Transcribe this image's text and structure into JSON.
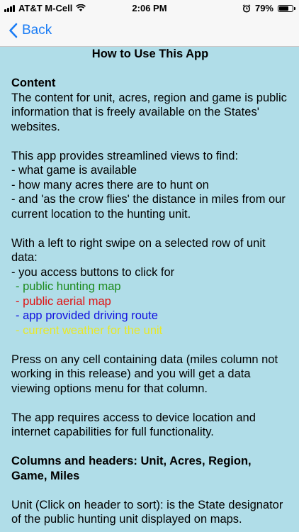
{
  "status_bar": {
    "carrier": "AT&T M-Cell",
    "time": "2:06 PM",
    "battery_percent": "79%",
    "battery_level": 0.79
  },
  "nav": {
    "back_label": "Back"
  },
  "page_title": "How to Use This App",
  "content_section": {
    "heading": "Content",
    "body": "The content for unit, acres, region and game is public information that is freely available on the States' websites."
  },
  "provides": {
    "intro": "This app provides streamlined views to find:",
    "items": [
      "- what game is available",
      "- how many acres there are to hunt on",
      "- and 'as the crow flies' the distance in miles from our current location to the hunting unit."
    ]
  },
  "swipe": {
    "intro": "With a left to right swipe on a selected row of unit data:",
    "lead": "- you access buttons to click for",
    "options": [
      {
        "text": "- public hunting map",
        "color": "#1c8a1c"
      },
      {
        "text": "- public aerial map",
        "color": "#e01010"
      },
      {
        "text": "- app provided driving route",
        "color": "#1010e0"
      },
      {
        "text": "- current weather for the unit",
        "color": "#e8e82a"
      }
    ]
  },
  "press_cell": "Press on any cell containing data (miles column not working in this release) and you will get a data viewing options menu for that column.",
  "requires": "The app requires access to device location and internet capabilities for full functionality.",
  "columns_heading": "Columns and headers:  Unit, Acres, Region, Game, Miles",
  "unit_desc": "Unit (Click on header to sort): is the State designator of the public hunting unit displayed on maps."
}
